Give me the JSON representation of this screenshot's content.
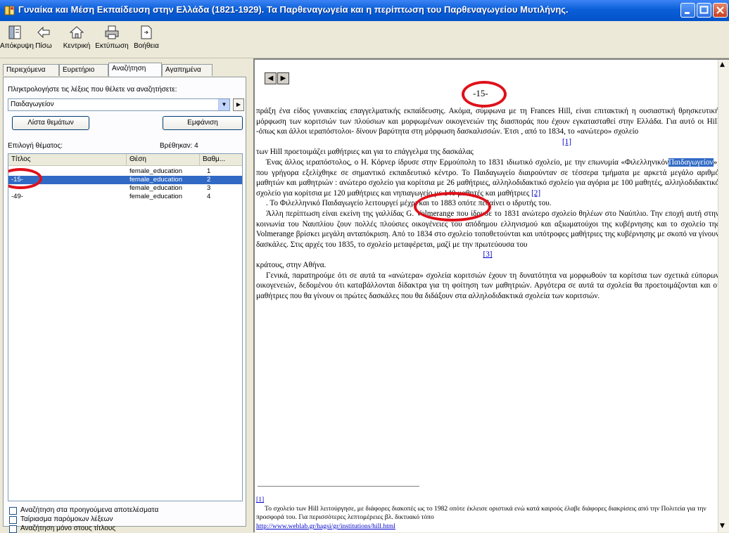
{
  "window": {
    "title": "Γυναίκα και Μέση Εκπαίδευση στην Ελλάδα (1821-1929). Τα Παρθεναγωγεία και η περίπτωση του Παρθεναγωγείου Μυτιλήνης."
  },
  "toolbar": {
    "buttons": [
      {
        "label": "Απόκρυψη",
        "icon": "hide-pane-icon"
      },
      {
        "label": "Πίσω",
        "icon": "back-arrow-icon"
      },
      {
        "label": "Κεντρική",
        "icon": "home-icon"
      },
      {
        "label": "Εκτύπωση",
        "icon": "printer-icon"
      },
      {
        "label": "Βοήθεια",
        "icon": "help-icon"
      }
    ]
  },
  "left": {
    "tabs": [
      "Περιεχόμενα",
      "Ευρετήριο",
      "Αναζήτηση",
      "Αγαπημένα"
    ],
    "active_tab": "Αναζήτηση",
    "prompt": "Πληκτρολογήστε τις λέξεις που θέλετε να αναζητήσετε:",
    "query": "Παιδαγωγείον",
    "list_topics_button": "Λίστα θεμάτων",
    "display_button": "Εμφάνιση",
    "select_topic_label": "Επιλογή θέματος:",
    "found_label": "Βρέθηκαν: 4",
    "columns": [
      "Τίτλος",
      "Θέση",
      "Βαθμ..."
    ],
    "rows": [
      {
        "title": "",
        "location": "female_education",
        "rank": "1"
      },
      {
        "title": "-15-",
        "location": "female_education",
        "rank": "2"
      },
      {
        "title": "",
        "location": "female_education",
        "rank": "3"
      },
      {
        "title": "-49-",
        "location": "female_education",
        "rank": "4"
      }
    ],
    "selected_row": 1,
    "options": [
      "Αναζήτηση στα προηγούμενα αποτελέσματα",
      "Ταίριασμα παρόμοιων λέξεων",
      "Αναζήτηση μόνο στους τίτλους"
    ]
  },
  "content": {
    "page_number": "-15-",
    "p1": "πράξη ένα είδος γυναικείας επαγγελματικής εκπαίδευσης. Ακόμα, σύμφωνα με τη Frances Hill, είναι επιτακτική η ουσιαστική θρησκευτική μόρφωση των κοριτσιών των πλούσιων και μορφωμένων οικογενειών της διασποράς που έχουν εγκατασταθεί στην Ελλάδα. Για αυτό οι Hill -όπως και άλλοι ιεραπόστολοι- δίνουν βαρύτητα στη μόρφωση δασκαλισσών. Έτσι , από το 1834, το «ανώτερο» σχολείο",
    "ref1": "[1]",
    "p2": "των Hill προετοιμάζει μαθήτριες και για το επάγγελμα της δασκάλας",
    "p3a": "Ένας άλλος ιεραπόστολος, ο Η. Κόρνερ ίδρυσε στην Ερμούπολη το 1831 ιδιωτικό σχολείο, με την επωνυμία «Φιλελληνικόν",
    "p3hl": "Παιδαγωγείον",
    "p3b": "», που γρήγορα εξελίχθηκε σε σημαντικό εκπαιδευτικό κέντρο. Το Παιδαγωγείο διαιρούνταν σε τέσσερα τμήματα με αρκετά μεγάλο αριθμό μαθητών και μαθητριών : ανώτερο σχολείο για κορίτσια με 26 μαθήτριες, αλληλοδιδακτικό σχολείο για αγόρια με 100 μαθητές, αλληλοδιδακτικό σχολείο για κορίτσια με 120 μαθήτριες και νηπιαγωγείο με 140 μαθητές και μαθήτριες",
    "ref2": "[2]",
    "p4": ". Το Φιλελληνικό Παιδαγωγείο λειτουργεί μέχρι και το 1883 οπότε πεθαίνει ο ιδρυτής του.",
    "p5": "Άλλη περίπτωση είναι εκείνη της γαλλίδας G. Volmerange που ίδρυσε το 1831 ανώτερο σχολείο θηλέων στο Ναύπλιο. Την εποχή αυτή στην κοινωνία του Ναυπλίου ζουν πολλές πλούσιες οικογένειες του απόδημου ελληνισμού και αξιωματούχοι της κυβέρνησης και το σχολείο της Volmerange βρίσκει μεγάλη ανταπόκριση. Από το 1834 στο σχολείο τοποθετούνται και υπότροφες μαθήτριες της κυβέρνησης με σκοπό να γίνουν δασκάλες. Στις αρχές του 1835, το σχολείο μεταφέρεται, μαζί με την πρωτεύουσα του",
    "ref3": "[3]",
    "p6": "κράτους, στην Αθήνα.",
    "p7": "Γενικά, παρατηρούμε ότι σε αυτά τα «ανώτερα» σχολεία κοριτσιών έχουν τη δυνατότητα να μορφωθούν τα κορίτσια των σχετικά εύπορων οικογενειών, δεδομένου ότι καταβάλλονται δίδακτρα για τη φοίτηση των μαθητριών. Αργότερα σε αυτά τα σχολεία θα προετοιμάζονται και οι μαθήτριες που θα γίνουν οι πρώτες δασκάλες που θα διδάξουν στα αλληλοδιδακτικά σχολεία των κοριτσιών.",
    "fn_mark": "[1]",
    "fn_text": "Το σχολείο των Hill λειτούργησε, με διάφορες διακοπές ως το 1982 οπότε έκλεισε οριστικά ενώ κατά καιρούς έλαβε διάφορες διακρίσεις από την Πολιτεία για την προσφορά του. Για περισσότερες λεπτομέρειες βλ. δικτυακό τόπο",
    "fn_link": "http://www.weblab.gr/hagsi/gr/institutions/hill.html"
  },
  "colors": {
    "title_bar": "#0a5fd8",
    "selection": "#316ac5",
    "annotation": "#e0101a",
    "link": "#0000cc"
  }
}
